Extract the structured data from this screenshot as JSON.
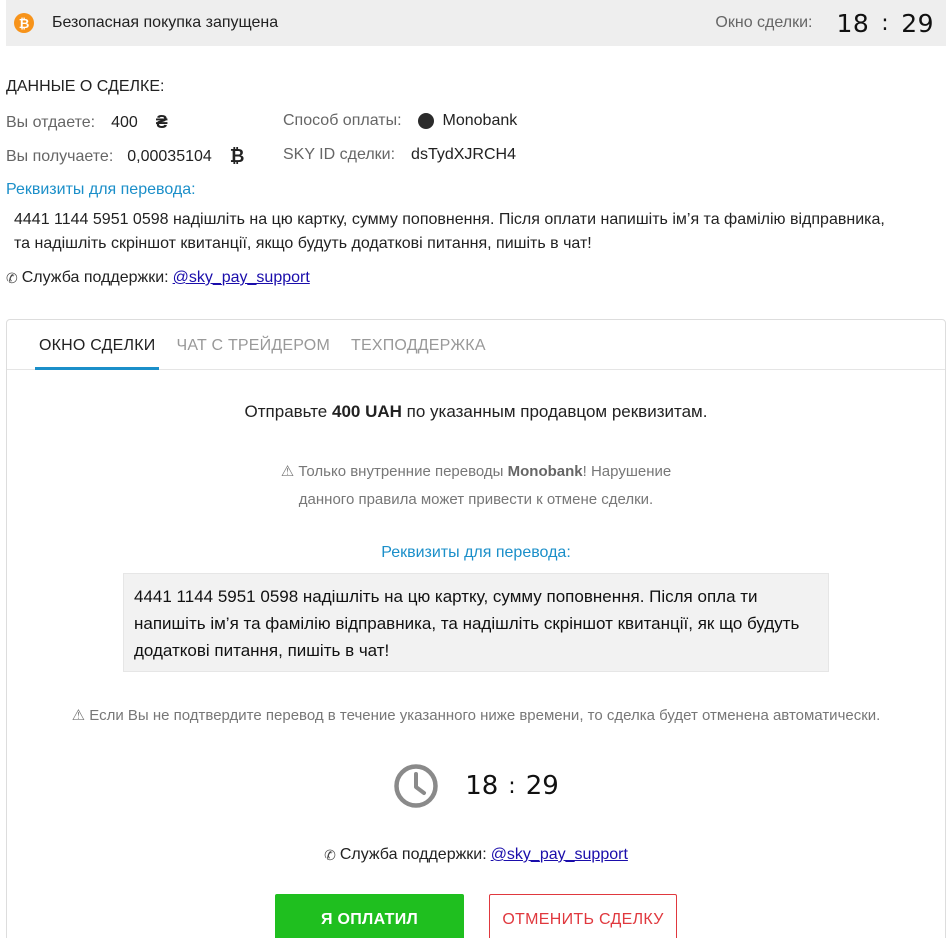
{
  "topbar": {
    "coin_symbol": "₿",
    "status": "Безопасная покупка запущена",
    "window_label": "Окно сделки:",
    "timer_minutes": "18",
    "timer_sep": ":",
    "timer_seconds": "29"
  },
  "details": {
    "title": "ДАННЫЕ О СДЕЛКЕ:",
    "give_label": "Вы отдаете:",
    "give_value": "400",
    "give_currency": "₴",
    "receive_label": "Вы получаете:",
    "receive_value": "0,00035104",
    "receive_currency": "₿",
    "payment_label": "Способ оплаты:",
    "payment_value": "Monobank",
    "id_label": "SKY ID сделки:",
    "id_value": "dsTydXJRCH4",
    "requisites_title": "Реквизиты для перевода:",
    "requisites_text": "4441 1144 5951 0598 надішліть на цю картку, сумму поповнення. Після оплати напишіть ім’я та фамілію відправника, та надішліть скріншот квитанції, якщо будуть додаткові питання, пишіть в чат!",
    "support_label": "Служба поддержки:",
    "support_link": "@sky_pay_support"
  },
  "tabs": [
    {
      "label": "ОКНО СДЕЛКИ",
      "active": true
    },
    {
      "label": "ЧАТ С ТРЕЙДЕРОМ",
      "active": false
    },
    {
      "label": "ТЕХПОДДЕРЖКА",
      "active": false
    }
  ],
  "deal": {
    "send_prefix": "Отправьте",
    "send_amount": "400 UAH",
    "send_suffix": "по указанным продавцом реквизитам.",
    "warn_prefix": "⚠ Только внутренние переводы",
    "warn_bank": "Monobank",
    "warn_line1_suffix": "! Нарушение",
    "warn_line2": "данного правила может привести к отмене сделки.",
    "requisites_title": "Реквизиты для перевода:",
    "requisites_text": "4441 1144 5951 0598 надішліть на цю картку, сумму поповнення. Після опла ти напишіть ім’я та фамілію відправника, та надішліть скріншот квитанції, як що будуть додаткові питання, пишіть в чат!",
    "timeout_warning": "⚠ Если Вы не подтвердите перевод в течение указанного ниже времени, то сделка будет отменена автоматически.",
    "timer_minutes": "18",
    "timer_sep": ":",
    "timer_seconds": "29",
    "support_label": "Служба поддержки:",
    "support_link": "@sky_pay_support",
    "paid_button": "Я ОПЛАТИЛ",
    "cancel_button": "ОТМЕНИТЬ СДЕЛКУ"
  },
  "colors": {
    "accent": "#1b8fc9",
    "paid": "#1fbf1f",
    "cancel": "#e0383e",
    "bitcoin": "#f7931a"
  }
}
